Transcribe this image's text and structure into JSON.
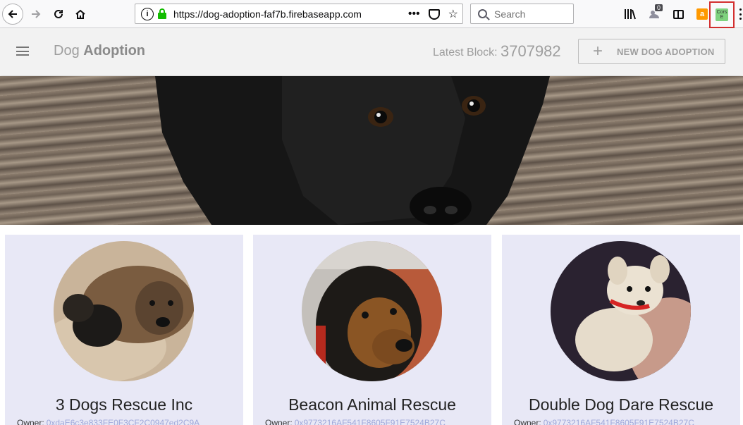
{
  "browser": {
    "url": "https://dog-adoption-faf7b.firebaseapp.com",
    "search_placeholder": "Search",
    "page_actions": "•••",
    "download_badge": "0",
    "amazon_label": "a",
    "cors_label": "Cors E"
  },
  "header": {
    "title_light": "Dog",
    "title_bold": "Adoption",
    "latest_block_label": "Latest Block:",
    "latest_block_value": "3707982",
    "new_button_plus": "+",
    "new_button_label": "NEW DOG ADOPTION"
  },
  "cards": [
    {
      "name": "3 Dogs Rescue Inc",
      "owner_label": "Owner:",
      "owner_address": "0xdaE6c3e833FE0F3CF2C0947ed2C9A"
    },
    {
      "name": "Beacon Animal Rescue",
      "owner_label": "Owner:",
      "owner_address": "0x9773216AF541F8605F91E7524B27C"
    },
    {
      "name": "Double Dog Dare Rescue",
      "owner_label": "Owner:",
      "owner_address": "0x9773216AF541F8605F91E7524B27C"
    }
  ]
}
